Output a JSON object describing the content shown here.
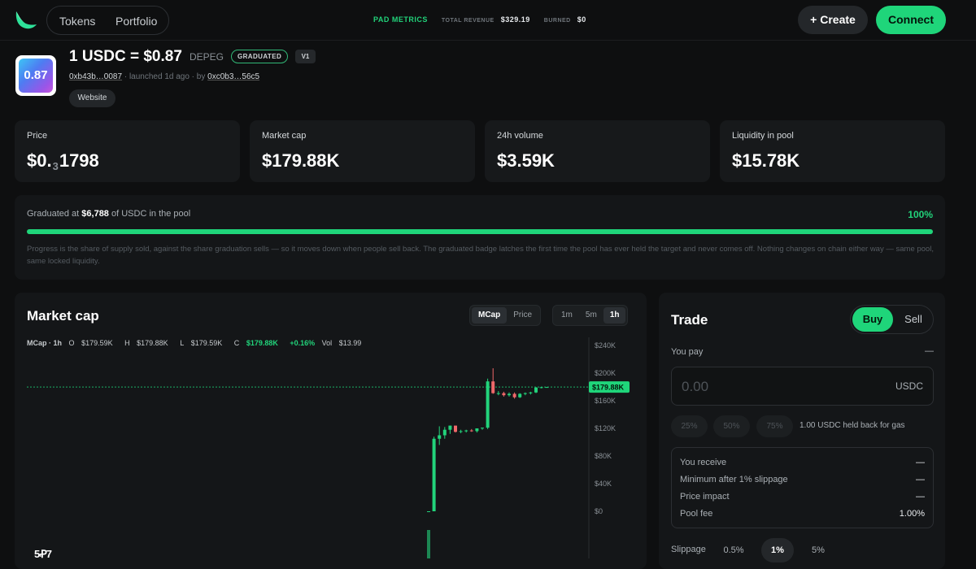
{
  "header": {
    "nav": {
      "tokens": "Tokens",
      "portfolio": "Portfolio"
    },
    "metrics": {
      "title": "PAD METRICS",
      "revenue_label": "TOTAL REVENUE",
      "revenue_value": "$329.19",
      "burned_label": "BURNED",
      "burned_value": "$0"
    },
    "create_label": "+ Create",
    "connect_label": "Connect"
  },
  "token": {
    "image_text": "0.87",
    "name": "1 USDC = $0.87",
    "symbol": "DEPEG",
    "graduated_badge": "GRADUATED",
    "version_badge": "V1",
    "address": "0xb43b…0087",
    "launched": "· launched 1d ago · by",
    "creator": "0xc0b3…56c5",
    "website_label": "Website"
  },
  "stats": [
    {
      "label": "Price",
      "value_prefix": "$0.",
      "value_sub": "3",
      "value_suffix": "1798"
    },
    {
      "label": "Market cap",
      "value": "$179.88K"
    },
    {
      "label": "24h volume",
      "value": "$3.59K"
    },
    {
      "label": "Liquidity in pool",
      "value": "$15.78K"
    }
  ],
  "graduation": {
    "label_prefix": "Graduated at",
    "amount": "$6,788",
    "label_suffix": "of USDC in the pool",
    "percent_text": "100%",
    "progress": 1.0,
    "note": "Progress is the share of supply sold, against the share graduation sells — so it moves down when people sell back. The graduated badge latches the first time the pool has ever held the target and never comes off. Nothing changes on chain either way — same pool, same locked liquidity."
  },
  "chart": {
    "title": "Market cap",
    "mode_tabs": [
      "MCap",
      "Price"
    ],
    "mode_selected": "MCap",
    "interval_tabs": [
      "1m",
      "5m",
      "1h"
    ],
    "interval_selected": "1h",
    "ohlc": {
      "label": "MCap · 1h",
      "o_key": "O",
      "o": "$179.59K",
      "h_key": "H",
      "h": "$179.88K",
      "l_key": "L",
      "l": "$179.59K",
      "c_key": "C",
      "c": "$179.88K",
      "change": "+0.16%",
      "vol_key": "Vol",
      "vol": "$13.99"
    },
    "y_ticks": [
      "$240K",
      "$200K",
      "$160K",
      "$120K",
      "$80K",
      "$40K",
      "$0"
    ],
    "current_label": "$179.88K",
    "colors": {
      "up": "#22d37b",
      "down": "#f0686a",
      "current": "#1fd57a"
    }
  },
  "chart_data": {
    "type": "candlestick",
    "ylim": [
      0,
      240000
    ],
    "current": 179880,
    "candles": [
      {
        "o": 0,
        "h": 0,
        "l": 0,
        "c": 0
      },
      {
        "o": 0,
        "h": 108000,
        "l": 0,
        "c": 105000
      },
      {
        "o": 105000,
        "h": 123000,
        "l": 96000,
        "c": 110000
      },
      {
        "o": 110000,
        "h": 122000,
        "l": 105000,
        "c": 118000
      },
      {
        "o": 118000,
        "h": 124000,
        "l": 112000,
        "c": 124000
      },
      {
        "o": 124000,
        "h": 124000,
        "l": 114000,
        "c": 115000
      },
      {
        "o": 115000,
        "h": 118000,
        "l": 113000,
        "c": 116000
      },
      {
        "o": 116000,
        "h": 118000,
        "l": 114000,
        "c": 117000
      },
      {
        "o": 117000,
        "h": 119000,
        "l": 115000,
        "c": 116000
      },
      {
        "o": 116000,
        "h": 120000,
        "l": 114000,
        "c": 120000
      },
      {
        "o": 120000,
        "h": 121000,
        "l": 118000,
        "c": 121000
      },
      {
        "o": 121000,
        "h": 192000,
        "l": 119000,
        "c": 188000
      },
      {
        "o": 188000,
        "h": 207000,
        "l": 170000,
        "c": 171000
      },
      {
        "o": 171000,
        "h": 174000,
        "l": 168000,
        "c": 171000
      },
      {
        "o": 171000,
        "h": 173000,
        "l": 166000,
        "c": 168000
      },
      {
        "o": 168000,
        "h": 172000,
        "l": 166000,
        "c": 170000
      },
      {
        "o": 170000,
        "h": 172000,
        "l": 163000,
        "c": 165000
      },
      {
        "o": 165000,
        "h": 171000,
        "l": 164000,
        "c": 170000
      },
      {
        "o": 170000,
        "h": 172000,
        "l": 168000,
        "c": 171000
      },
      {
        "o": 171000,
        "h": 173000,
        "l": 169000,
        "c": 172000
      },
      {
        "o": 172000,
        "h": 180000,
        "l": 171000,
        "c": 179000
      },
      {
        "o": 179000,
        "h": 180000,
        "l": 178000,
        "c": 179590
      },
      {
        "o": 179590,
        "h": 180000,
        "l": 179000,
        "c": 179880
      }
    ]
  },
  "trade": {
    "title": "Trade",
    "buy_label": "Buy",
    "sell_label": "Sell",
    "you_pay_label": "You pay",
    "you_pay_value": "—",
    "amount_placeholder": "0.00",
    "currency": "USDC",
    "quick": [
      "25%",
      "50%",
      "75%"
    ],
    "gas_note": "1.00 USDC held back for gas",
    "rows": [
      {
        "label": "You receive",
        "value": "—"
      },
      {
        "label": "Minimum after 1% slippage",
        "value": "—"
      },
      {
        "label": "Price impact",
        "value": "—"
      },
      {
        "label": "Pool fee",
        "value": "1.00%"
      }
    ],
    "slippage_label": "Slippage",
    "slippage_options": [
      "0.5%",
      "1%",
      "5%"
    ],
    "slippage_selected": "1%"
  },
  "watermark": "5Ꝓ7"
}
